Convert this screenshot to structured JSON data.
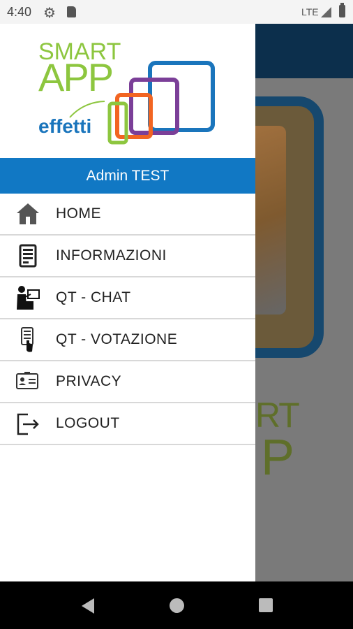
{
  "status_bar": {
    "time": "4:40",
    "network": "LTE",
    "icons": [
      "settings-icon",
      "sd-card-icon",
      "signal-icon",
      "battery-icon"
    ]
  },
  "logo": {
    "line1": "SMART",
    "line2": "APP",
    "line3": "effetti"
  },
  "background": {
    "text_line1": "RT",
    "text_line2": "P"
  },
  "user": {
    "name": "Admin TEST"
  },
  "menu": {
    "items": [
      {
        "label": "HOME",
        "icon": "home-icon"
      },
      {
        "label": "INFORMAZIONI",
        "icon": "info-device-icon"
      },
      {
        "label": "QT - CHAT",
        "icon": "presenter-chat-icon"
      },
      {
        "label": "QT - VOTAZIONE",
        "icon": "vote-touch-icon"
      },
      {
        "label": "PRIVACY",
        "icon": "id-card-icon"
      },
      {
        "label": "LOGOUT",
        "icon": "logout-icon"
      }
    ]
  },
  "colors": {
    "accent": "#1178c4",
    "logo_green": "#8dc63f",
    "logo_blue": "#1a75bc",
    "logo_purple": "#7b3f98",
    "logo_orange": "#f26522"
  },
  "navigation": {
    "buttons": [
      "back-icon",
      "home-circle-icon",
      "recents-icon"
    ]
  }
}
